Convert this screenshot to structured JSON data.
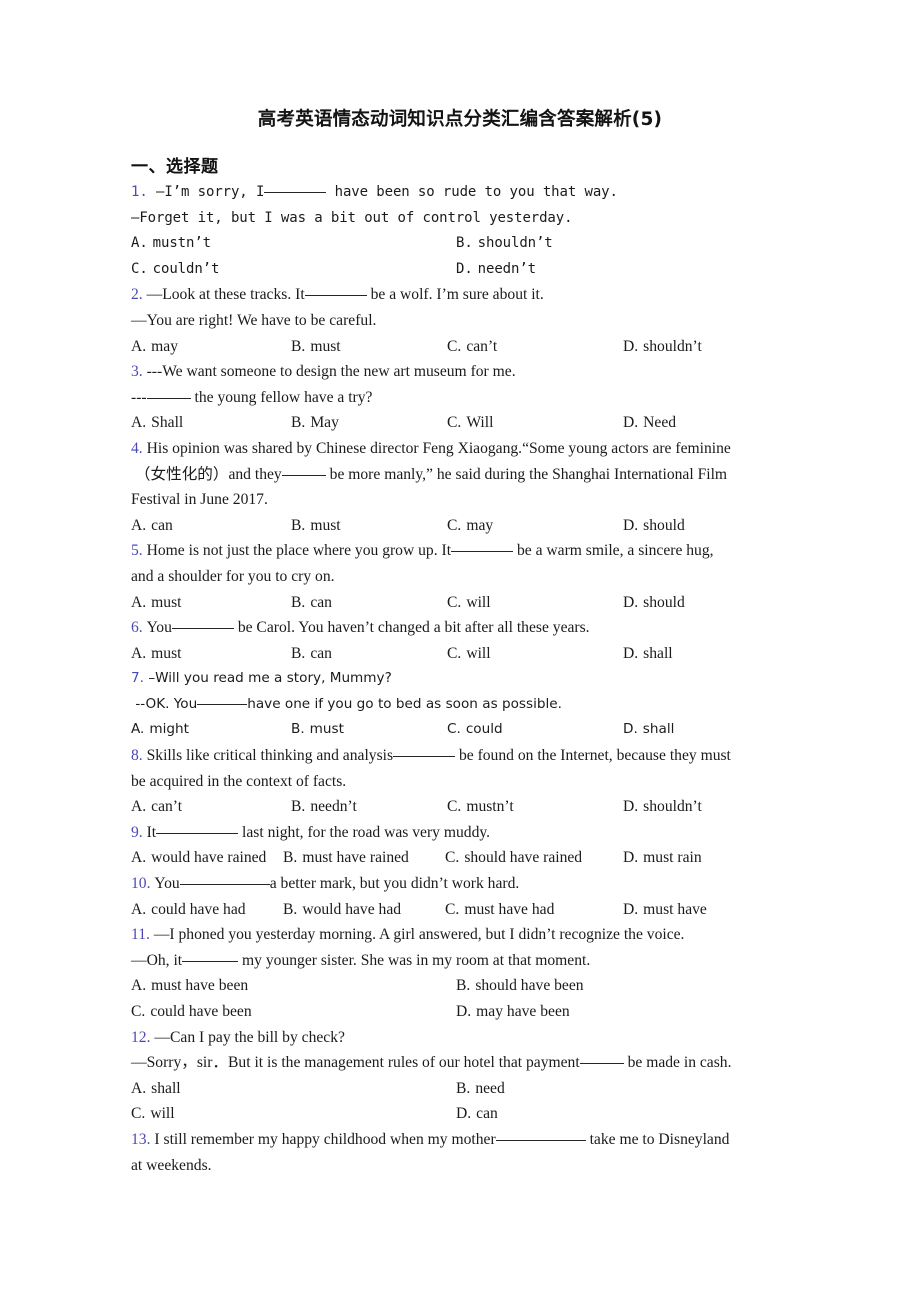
{
  "document": {
    "title": "高考英语情态动词知识点分类汇编含答案解析(5)",
    "section_heading": "一、选择题",
    "accent_color": "#4b49b6",
    "text_color": "#1b1b1b"
  },
  "questions": [
    {
      "number": "1.",
      "stem_1": "—I’m sorry, I",
      "stem_2": "have been so rude to you that way.",
      "stem_3": "—Forget it, but I was a bit out of control yesterday.",
      "options": [
        {
          "label": "A.",
          "text": "mustn’t"
        },
        {
          "label": "B.",
          "text": "shouldn’t"
        },
        {
          "label": "C.",
          "text": "couldn’t"
        },
        {
          "label": "D.",
          "text": "needn’t"
        }
      ]
    },
    {
      "number": "2.",
      "stem_1": "—Look at these tracks. It",
      "stem_2": "be a wolf. I’m sure about it.",
      "stem_3": "—You are right! We have to be careful.",
      "options": [
        {
          "label": "A.",
          "text": "may"
        },
        {
          "label": "B.",
          "text": "must"
        },
        {
          "label": "C.",
          "text": "can’t"
        },
        {
          "label": "D.",
          "text": "shouldn’t"
        }
      ]
    },
    {
      "number": "3.",
      "stem_1": "---We want someone to design the new art museum for me.",
      "stem_2": "---",
      "stem_3": "the young fellow have a try?",
      "options": [
        {
          "label": "A.",
          "text": "Shall"
        },
        {
          "label": "B.",
          "text": "May"
        },
        {
          "label": "C.",
          "text": "Will"
        },
        {
          "label": "D.",
          "text": "Need"
        }
      ]
    },
    {
      "number": "4.",
      "stem_1": "His opinion was shared by Chinese director Feng Xiaogang.“Some young actors are feminine",
      "stem_2": "（女性化的）and they",
      "stem_3": "be more manly,” he said during the Shanghai International Film",
      "stem_4": "Festival in June 2017.",
      "options": [
        {
          "label": "A.",
          "text": "can"
        },
        {
          "label": "B.",
          "text": "must"
        },
        {
          "label": "C.",
          "text": "may"
        },
        {
          "label": "D.",
          "text": "should"
        }
      ]
    },
    {
      "number": "5.",
      "stem_1": "Home is not just the place where you grow up. It",
      "stem_2": "be a warm smile, a sincere hug,",
      "stem_3": "and a shoulder for you to cry on.",
      "options": [
        {
          "label": "A.",
          "text": "must"
        },
        {
          "label": "B.",
          "text": "can"
        },
        {
          "label": "C.",
          "text": "will"
        },
        {
          "label": "D.",
          "text": "should"
        }
      ]
    },
    {
      "number": "6.",
      "stem_1": "You",
      "stem_2": "be Carol. You haven’t changed a bit after all these years.",
      "options": [
        {
          "label": "A.",
          "text": "must"
        },
        {
          "label": "B.",
          "text": "can"
        },
        {
          "label": "C.",
          "text": "will"
        },
        {
          "label": "D.",
          "text": "shall"
        }
      ]
    },
    {
      "number": "7.",
      "stem_1": "–Will you read me a story, Mummy?",
      "stem_2": "--OK. You",
      "stem_3": "have one if you go to bed as soon as possible.",
      "options": [
        {
          "label": "A.",
          "text": "might"
        },
        {
          "label": "B.",
          "text": "must"
        },
        {
          "label": "C.",
          "text": "could"
        },
        {
          "label": "D.",
          "text": "shall"
        }
      ]
    },
    {
      "number": "8.",
      "stem_1": "Skills like critical thinking and analysis",
      "stem_2": "be found on the Internet, because they must",
      "stem_3": "be acquired in the context of facts.",
      "options": [
        {
          "label": "A.",
          "text": "can’t"
        },
        {
          "label": "B.",
          "text": "needn’t"
        },
        {
          "label": "C.",
          "text": "mustn’t"
        },
        {
          "label": "D.",
          "text": "shouldn’t"
        }
      ]
    },
    {
      "number": "9.",
      "stem_1": "It",
      "stem_2": "last night, for the road was very muddy.",
      "options": [
        {
          "label": "A.",
          "text": "would have rained"
        },
        {
          "label": "B.",
          "text": "must have rained"
        },
        {
          "label": "C.",
          "text": "should have rained"
        },
        {
          "label": "D.",
          "text": "must rain"
        }
      ]
    },
    {
      "number": "10.",
      "stem_1": "You",
      "stem_2": "a better mark, but you didn’t work hard.",
      "options": [
        {
          "label": "A.",
          "text": "could have had"
        },
        {
          "label": "B.",
          "text": "would have had"
        },
        {
          "label": "C.",
          "text": "must have had"
        },
        {
          "label": "D.",
          "text": "must have"
        }
      ]
    },
    {
      "number": "11.",
      "stem_1": "—I phoned you yesterday morning. A girl answered, but I didn’t recognize the voice.",
      "stem_2": "—Oh, it",
      "stem_3": "my younger sister. She was in my room at that moment.",
      "options": [
        {
          "label": "A.",
          "text": "must have been"
        },
        {
          "label": "B.",
          "text": "should have been"
        },
        {
          "label": "C.",
          "text": "could have been"
        },
        {
          "label": "D.",
          "text": "may have been"
        }
      ]
    },
    {
      "number": "12.",
      "stem_1": "—Can I pay the bill by check?",
      "stem_2": "—Sorry，sir．But it is the management rules of our hotel that payment",
      "stem_3": "be made in cash.",
      "options": [
        {
          "label": "A.",
          "text": "shall"
        },
        {
          "label": "B.",
          "text": "need"
        },
        {
          "label": "C.",
          "text": "will"
        },
        {
          "label": "D.",
          "text": "can"
        }
      ]
    },
    {
      "number": "13.",
      "stem_1": "I still remember my happy childhood when my mother",
      "stem_2": "take me to Disneyland",
      "stem_3": "at weekends."
    }
  ]
}
